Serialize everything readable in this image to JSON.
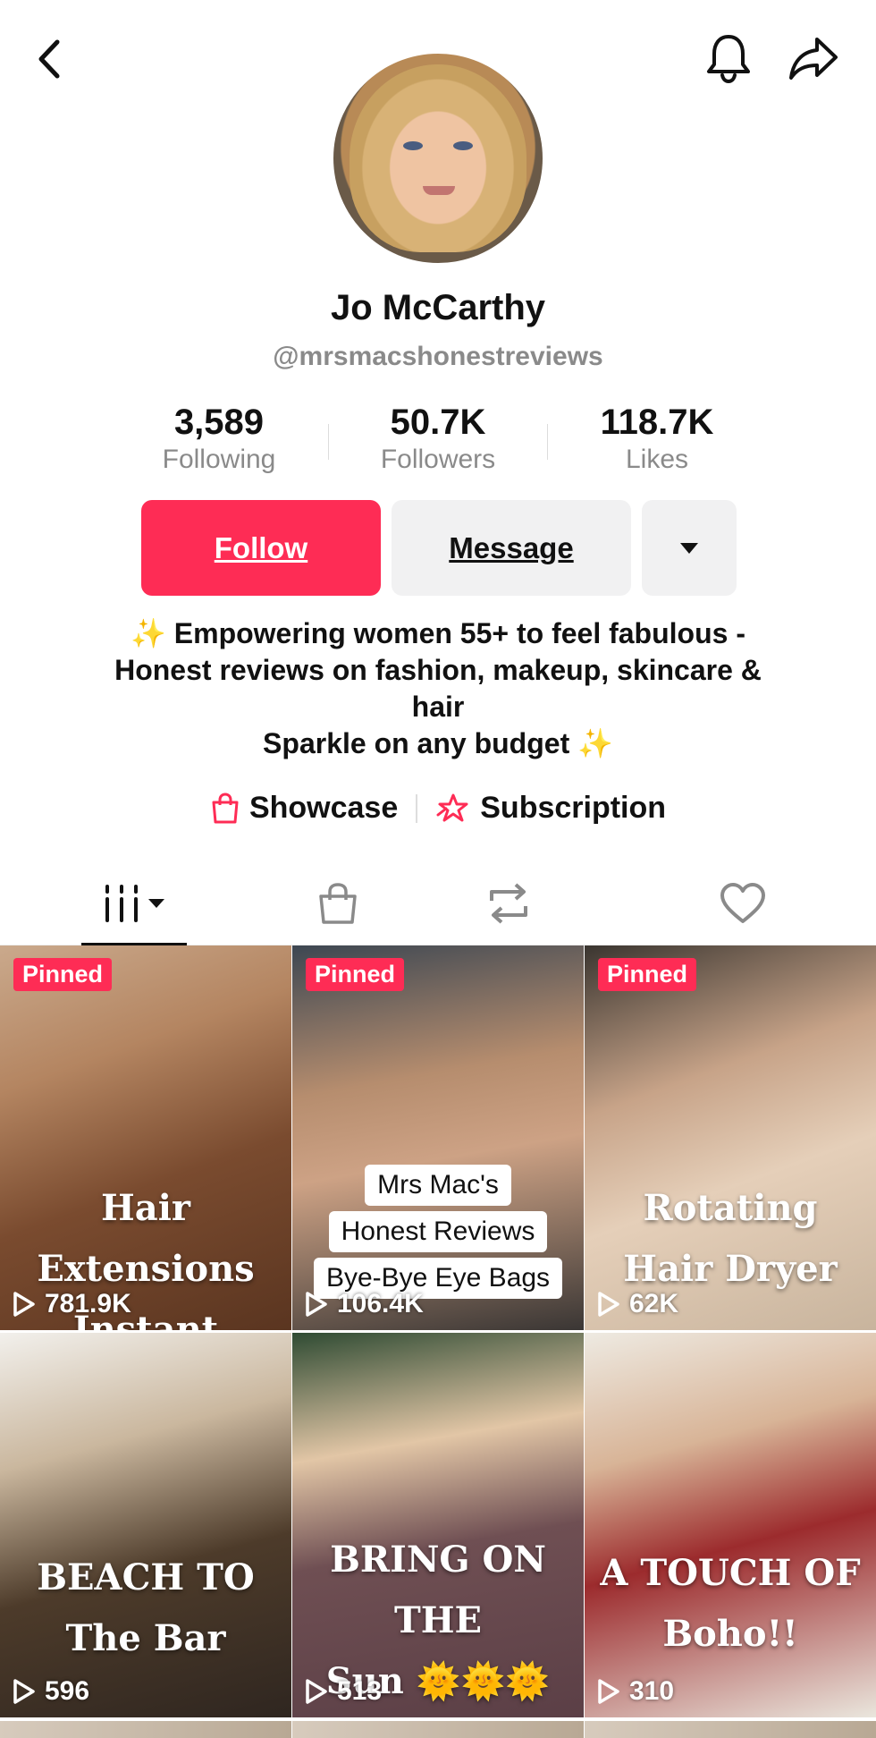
{
  "profile": {
    "name": "Jo McCarthy",
    "handle": "@mrsmacshonestreviews"
  },
  "stats": [
    {
      "value": "3,589",
      "label": "Following"
    },
    {
      "value": "50.7K",
      "label": "Followers"
    },
    {
      "value": "118.7K",
      "label": "Likes"
    }
  ],
  "actions": {
    "follow": "Follow",
    "message": "Message"
  },
  "bio": {
    "line1": "Empowering women 55+ to feel fabulous -",
    "line2": "Honest reviews on fashion, makeup, skincare &",
    "line3": "hair",
    "line4": "Sparkle on any budget",
    "sparkle": "✨"
  },
  "links": {
    "showcase": "Showcase",
    "subscription": "Subscription"
  },
  "colors": {
    "accent": "#fe2c55",
    "secondary_button": "#f1f1f2",
    "muted_text": "#8a8a8a"
  },
  "videos": [
    {
      "pinned": "Pinned",
      "caption": [
        "Hair Extensions",
        "Instant Fullness"
      ],
      "views": "781.9K"
    },
    {
      "pinned": "Pinned",
      "boxed_caption": [
        "Mrs Mac's",
        "Honest Reviews",
        "Bye-Bye Eye Bags"
      ],
      "views": "106.4K"
    },
    {
      "pinned": "Pinned",
      "caption": [
        "Rotating",
        "Hair Dryer"
      ],
      "views": "62K"
    },
    {
      "caption": [
        "BEACH TO",
        "The Bar"
      ],
      "views": "596"
    },
    {
      "caption": [
        "BRING ON THE",
        "Sun 🌞🌞🌞"
      ],
      "views": "513"
    },
    {
      "caption": [
        "A TOUCH OF",
        "Boho!!"
      ],
      "views": "310"
    }
  ]
}
